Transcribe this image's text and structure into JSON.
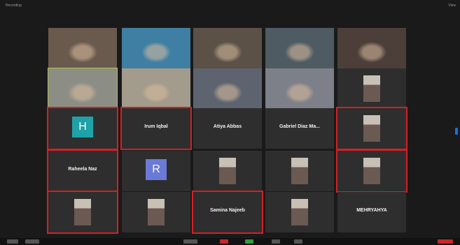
{
  "window": {
    "recording_label": "Recording",
    "view_label": "View"
  },
  "participants": [
    {
      "name": "",
      "type": "video",
      "bg": "#6a5a4e"
    },
    {
      "name": "",
      "type": "video",
      "bg": "#3f7fa3"
    },
    {
      "name": "",
      "type": "video",
      "bg": "#5b5147"
    },
    {
      "name": "",
      "type": "video",
      "bg": "#4f5b63"
    },
    {
      "name": "",
      "type": "video",
      "bg": "#4c3f3a"
    },
    {
      "name": "",
      "type": "video",
      "bg": "#8c8e86"
    },
    {
      "name": "",
      "type": "video",
      "bg": "#a39b8b"
    },
    {
      "name": "",
      "type": "video",
      "bg": "#5d6470"
    },
    {
      "name": "",
      "type": "video",
      "bg": "#7d8088"
    },
    {
      "name": "",
      "type": "photo",
      "bg": "#2e2e2e"
    },
    {
      "name": "",
      "type": "avatar",
      "initial": "H",
      "bg": "#2e2e2e",
      "avatar_color": "#1ea2a8"
    },
    {
      "name": "Irum Iqbal",
      "type": "text"
    },
    {
      "name": "Atiya Abbas",
      "type": "text"
    },
    {
      "name": "Gabriel Diaz Ma...",
      "type": "text"
    },
    {
      "name": "",
      "type": "photo",
      "bg": "#2e2e2e"
    },
    {
      "name": "Raheela Naz",
      "type": "text"
    },
    {
      "name": "",
      "type": "avatar",
      "initial": "R",
      "bg": "#2e2e2e",
      "avatar_color": "#6b79d8"
    },
    {
      "name": "",
      "type": "photo",
      "bg": "#2e2e2e"
    },
    {
      "name": "",
      "type": "photo",
      "bg": "#2e2e2e"
    },
    {
      "name": "",
      "type": "photo",
      "bg": "#2e2e2e"
    },
    {
      "name": "",
      "type": "photo",
      "bg": "#2e2e2e"
    },
    {
      "name": "",
      "type": "photo",
      "bg": "#2e2e2e"
    },
    {
      "name": "Samina Najeeb",
      "type": "text"
    },
    {
      "name": "",
      "type": "photo",
      "bg": "#2e2e2e"
    },
    {
      "name": "MEHRYAHYA",
      "type": "text"
    }
  ],
  "colors": {
    "highlight": "#d61f26",
    "active_speaker": "#b5c23a"
  }
}
